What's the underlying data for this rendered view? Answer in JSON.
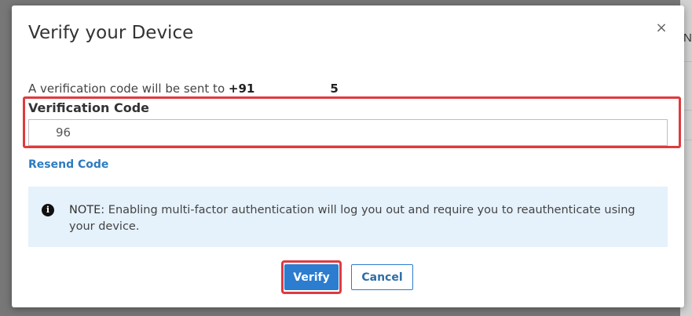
{
  "backdrop": {
    "fragment": "N"
  },
  "dialog": {
    "title": "Verify your Device",
    "close_glyph": "×",
    "info_prefix": "A verification code will be sent to",
    "phone_start": "+91",
    "phone_end": "5",
    "field_label": "Verification Code",
    "code_value": "96",
    "resend_label": "Resend Code",
    "note_label": "NOTE:",
    "note_text": "Enabling multi-factor authentication will log you out and require you to reauthenticate using your device.",
    "note_icon": "info-icon",
    "verify_label": "Verify",
    "cancel_label": "Cancel"
  },
  "colors": {
    "accent": "#2c7ccf",
    "highlight": "#e03a3e",
    "note_bg": "#e5f1fb"
  }
}
